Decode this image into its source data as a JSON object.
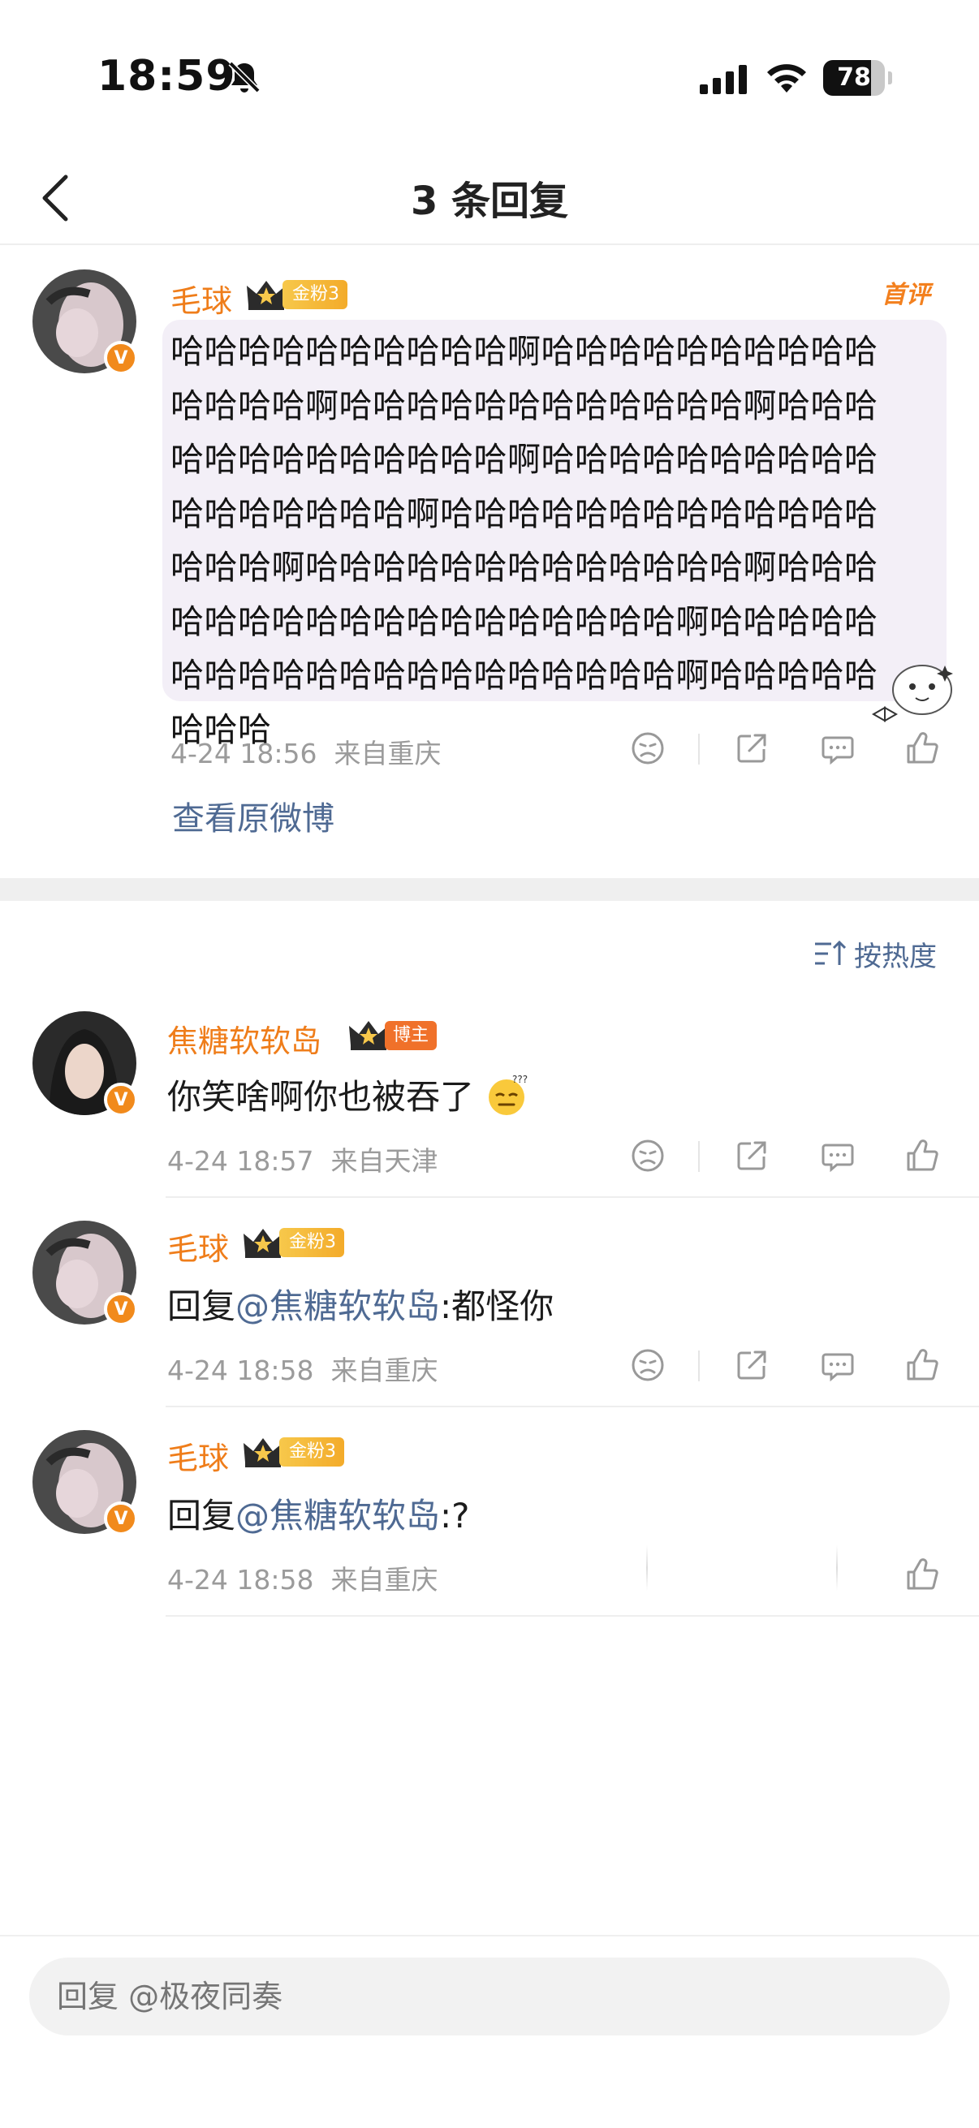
{
  "status_bar": {
    "time": "18:59",
    "battery": "78",
    "battery_level": 0.78
  },
  "nav": {
    "title": "3 条回复"
  },
  "main_comment": {
    "username": "毛球",
    "fan_tag": "金粉3",
    "first_badge": "首评",
    "text": "哈哈哈哈哈哈哈哈哈哈啊哈哈哈哈哈哈哈哈哈哈哈哈哈哈啊哈哈哈哈哈哈哈哈哈哈哈哈啊哈哈哈哈哈哈哈哈哈哈哈哈哈啊哈哈哈哈哈哈哈哈哈哈哈哈哈哈哈哈哈啊哈哈哈哈哈哈哈哈哈哈哈哈哈哈哈哈啊哈哈哈哈哈哈哈哈哈哈哈哈哈啊哈哈哈哈哈哈哈哈哈哈哈哈哈哈哈哈哈哈啊哈哈哈哈哈哈哈哈哈哈哈哈哈哈哈哈哈哈哈哈啊哈哈哈哈哈哈哈哈",
    "date": "4-24 18:56",
    "location": "来自重庆",
    "view_original": "查看原微博"
  },
  "sort_label": "按热度",
  "replies": [
    {
      "username": "焦糖软软岛",
      "tag": "博主",
      "text": "你笑啥啊你也被吞了",
      "date": "4-24 18:57",
      "location": "来自天津"
    },
    {
      "username": "毛球",
      "tag": "金粉3",
      "prefix": "回复",
      "mention": "@焦糖软软岛",
      "text": ":都怪你",
      "date": "4-24 18:58",
      "location": "来自重庆"
    },
    {
      "username": "毛球",
      "tag": "金粉3",
      "prefix": "回复",
      "mention": "@焦糖软软岛",
      "text": ":?",
      "date": "4-24 18:58",
      "location": "来自重庆"
    }
  ],
  "reply_input": {
    "placeholder": "回复 @极夜同奏"
  },
  "colors": {
    "username": "#ef7d1a",
    "link": "#4f6a93",
    "badge": "#f18a1c"
  },
  "icons": [
    "back-arrow-icon",
    "bell-off-icon",
    "signal-icon",
    "wifi-icon",
    "battery-icon",
    "crown-icon",
    "dislike-face-icon",
    "share-icon",
    "comment-icon",
    "like-icon",
    "sort-icon",
    "squint-emoji-icon"
  ]
}
